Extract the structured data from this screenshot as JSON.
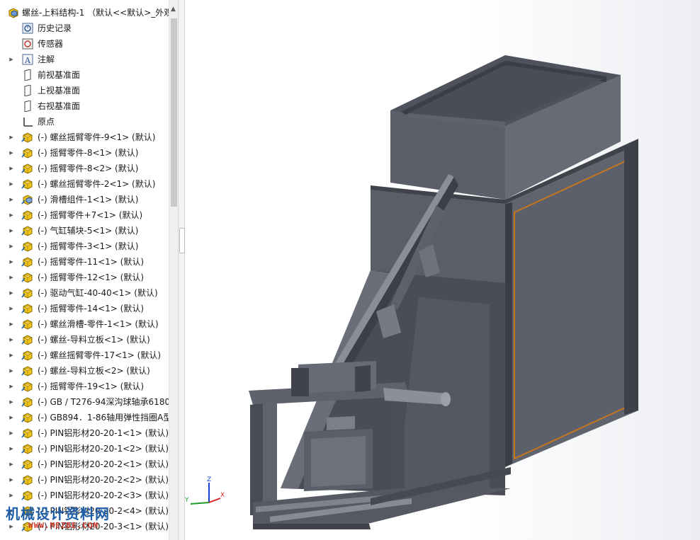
{
  "tree": {
    "root": "螺丝-上料结构-1 （默认<<默认>_外观",
    "items": [
      {
        "label": "历史记录",
        "icon": "history-icon",
        "expandable": false
      },
      {
        "label": "传感器",
        "icon": "sensor-icon",
        "expandable": false
      },
      {
        "label": "注解",
        "icon": "annotation-icon",
        "expandable": true
      },
      {
        "label": "前视基准面",
        "icon": "plane-icon",
        "expandable": false
      },
      {
        "label": "上视基准面",
        "icon": "plane-icon",
        "expandable": false
      },
      {
        "label": "右视基准面",
        "icon": "plane-icon",
        "expandable": false
      },
      {
        "label": "原点",
        "icon": "origin-icon",
        "expandable": false
      },
      {
        "label": "(-) 螺丝摇臂零件-9<1> (默认)",
        "icon": "part-icon",
        "expandable": true
      },
      {
        "label": "(-) 摇臂零件-8<1> (默认)",
        "icon": "part-icon",
        "expandable": true
      },
      {
        "label": "(-) 摇臂零件-8<2> (默认)",
        "icon": "part-icon",
        "expandable": true
      },
      {
        "label": "(-) 螺丝摇臂零件-2<1> (默认)",
        "icon": "part-icon",
        "expandable": true
      },
      {
        "label": "(-) 滑槽组件-1<1> (默认)",
        "icon": "assembly-icon",
        "expandable": true
      },
      {
        "label": "(-) 摇臂零件+7<1> (默认)",
        "icon": "part-icon",
        "expandable": true
      },
      {
        "label": "(-) 气缸辅块-5<1> (默认)",
        "icon": "part-icon",
        "expandable": true
      },
      {
        "label": "(-) 摇臂零件-3<1> (默认)",
        "icon": "part-icon",
        "expandable": true
      },
      {
        "label": "(-) 摇臂零件-11<1> (默认)",
        "icon": "part-icon",
        "expandable": true
      },
      {
        "label": "(-) 摇臂零件-12<1> (默认)",
        "icon": "part-icon",
        "expandable": true
      },
      {
        "label": "(-) 驱动气缸-40-40<1> (默认)",
        "icon": "part-icon",
        "expandable": true
      },
      {
        "label": "(-) 摇臂零件-14<1> (默认)",
        "icon": "part-icon",
        "expandable": true
      },
      {
        "label": "(-) 螺丝滑槽-零件-1<1> (默认)",
        "icon": "part-icon",
        "expandable": true
      },
      {
        "label": "(-) 螺丝-导料立板<1> (默认)",
        "icon": "part-icon",
        "expandable": true
      },
      {
        "label": "(-) 螺丝摇臂零件-17<1> (默认)",
        "icon": "part-icon",
        "expandable": true
      },
      {
        "label": "(-) 螺丝-导料立板<2> (默认)",
        "icon": "part-icon",
        "expandable": true
      },
      {
        "label": "(-) 摇臂零件-19<1> (默认)",
        "icon": "part-icon",
        "expandable": true
      },
      {
        "label": "(-) GB / T276-94深沟球轴承6180",
        "icon": "part-icon",
        "expandable": true
      },
      {
        "label": "(-) GB894．1-86轴用弹性挡圈A型",
        "icon": "part-icon",
        "expandable": true
      },
      {
        "label": "(-) PIN铝形材20-20-1<1> (默认)",
        "icon": "part-icon",
        "expandable": true
      },
      {
        "label": "(-) PIN铝形材20-20-1<2> (默认)",
        "icon": "part-icon",
        "expandable": true
      },
      {
        "label": "(-) PIN铝形材20-20-2<1> (默认)",
        "icon": "part-icon",
        "expandable": true
      },
      {
        "label": "(-) PIN铝形材20-20-2<2> (默认)",
        "icon": "part-icon",
        "expandable": true
      },
      {
        "label": "(-) PIN铝形材20-20-2<3> (默认)",
        "icon": "part-icon",
        "expandable": true
      },
      {
        "label": "(-) PIN铝形材20-20-2<4> (默认)",
        "icon": "part-icon",
        "expandable": true
      },
      {
        "label": "(-) PIN铝形材20-20-3<1> (默认)",
        "icon": "part-icon",
        "expandable": true
      }
    ]
  },
  "watermark": {
    "line1": "机械设计资料网",
    "line2": "WWW.MEZBE.COM"
  },
  "triad": {
    "x": "X",
    "y": "Y",
    "z": "Z"
  },
  "colors": {
    "model_body": "#565a66",
    "model_dark": "#3a3d45",
    "model_light": "#7d818c",
    "panel_edge": "#c8761c",
    "part_icon": "#f0c419"
  }
}
